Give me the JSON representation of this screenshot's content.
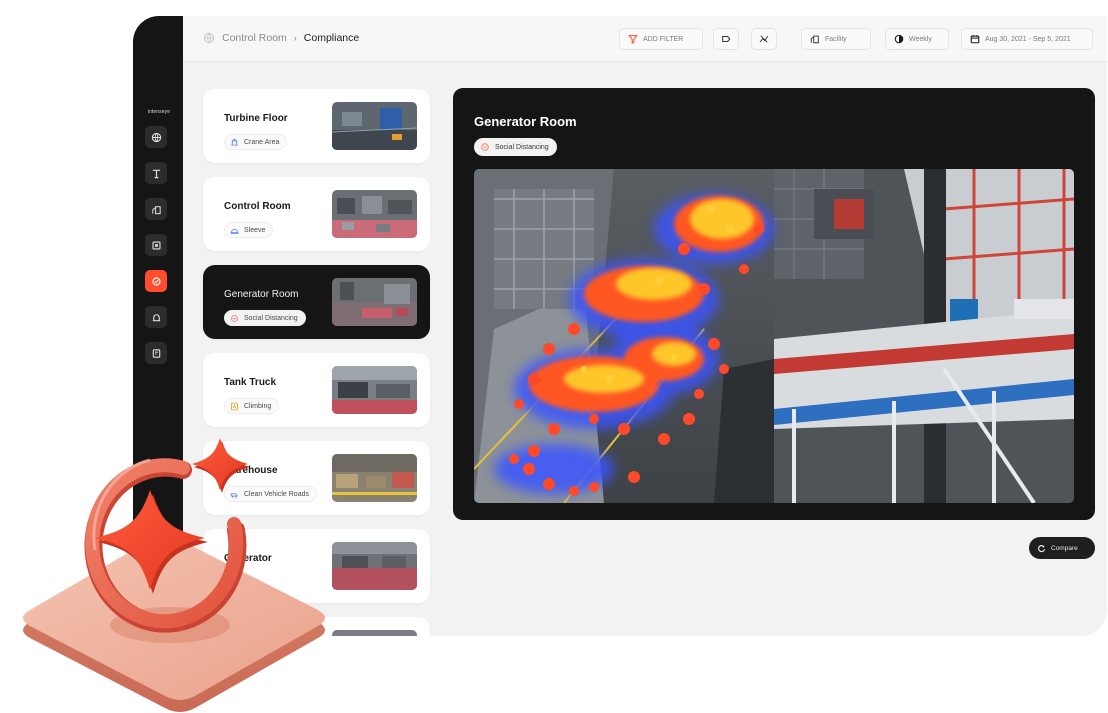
{
  "brand": "intenseye",
  "breadcrumb": {
    "root": "Control Room",
    "separator": "›",
    "current": "Compliance"
  },
  "toolbar": {
    "add_filter": "ADD FILTER",
    "facility": "Facility",
    "period": "Weekly",
    "date_range": "Aug 30, 2021 - Sep 5, 2021"
  },
  "sidebar": {
    "items": [
      {
        "icon": "globe-icon"
      },
      {
        "icon": "crane-icon"
      },
      {
        "icon": "factory-icon"
      },
      {
        "icon": "box-icon"
      },
      {
        "icon": "compliance-icon",
        "active": true
      },
      {
        "icon": "alert-icon"
      },
      {
        "icon": "report-icon"
      }
    ]
  },
  "cameras": [
    {
      "name": "Turbine Floor",
      "rule": "Crane Area",
      "rule_icon": "crane-icon"
    },
    {
      "name": "Control Room",
      "rule": "Sleeve",
      "rule_icon": "helmet-icon"
    },
    {
      "name": "Generator Room",
      "rule": "Social Distancing",
      "rule_icon": "distance-icon",
      "active": true
    },
    {
      "name": "Tank Truck",
      "rule": "Climbing",
      "rule_icon": "climb-icon"
    },
    {
      "name": "Warehouse",
      "rule": "Clean Vehicle Roads",
      "rule_icon": "vehicle-icon"
    },
    {
      "name": "Generator",
      "rule": "",
      "rule_icon": ""
    }
  ],
  "viewer": {
    "title": "Generator Room",
    "tag": "Social Distancing"
  },
  "compare_label": "Compare",
  "colors": {
    "accent": "#ff4d2e",
    "sidebar": "#151515",
    "panel": "#f2f2f2",
    "heat_hot": "#ffcc2a",
    "heat_mid": "#ff5722"
  }
}
